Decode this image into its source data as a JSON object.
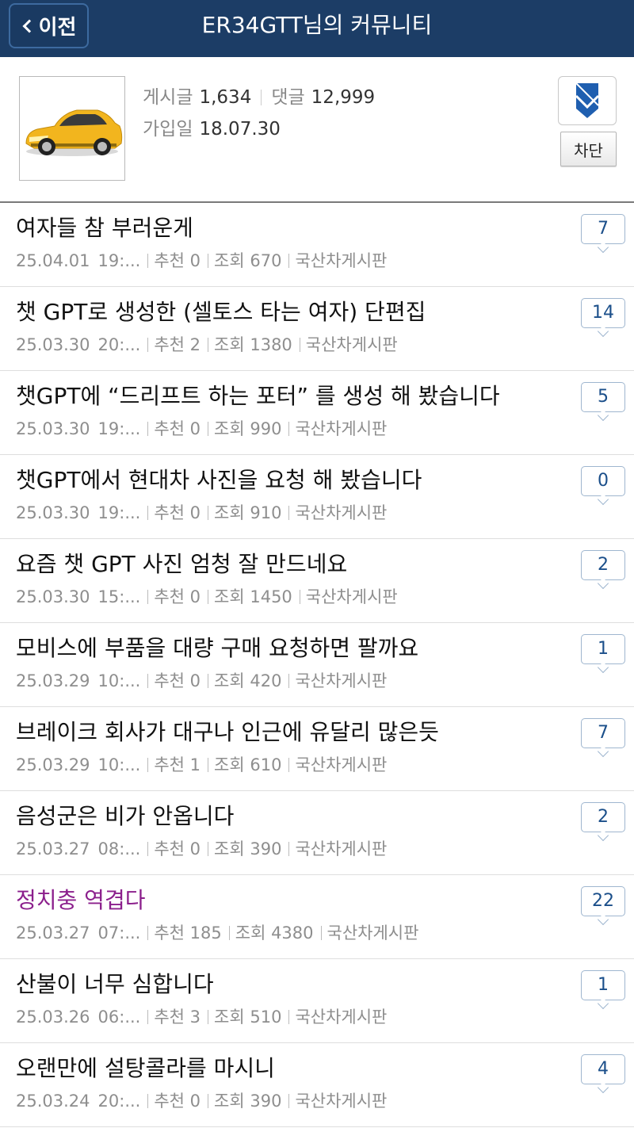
{
  "header": {
    "back_label": "이전",
    "title": "ER34GTT님의 커뮤니티",
    "background_color": "#1c3d66"
  },
  "profile": {
    "posts_label": "게시글",
    "posts_count": "1,634",
    "comments_label": "댓글",
    "comments_count": "12,999",
    "joined_label": "가입일",
    "joined_date": "18.07.30",
    "block_label": "차단",
    "bookmark_icon": "bookmark-icon"
  },
  "posts": [
    {
      "title": "여자들 참 부러운게",
      "date": "25.04.01",
      "time": "19:...",
      "recommend": "추천 0",
      "views": "조회 670",
      "board": "국산차게시판",
      "comments": "7",
      "highlight": false
    },
    {
      "title": "챗 GPT로 생성한 (셀토스 타는 여자) 단편집",
      "date": "25.03.30",
      "time": "20:...",
      "recommend": "추천 2",
      "views": "조회 1380",
      "board": "국산차게시판",
      "comments": "14",
      "highlight": false
    },
    {
      "title": "챗GPT에 “드리프트 하는 포터” 를 생성 해 봤습니다",
      "date": "25.03.30",
      "time": "19:...",
      "recommend": "추천 0",
      "views": "조회 990",
      "board": "국산차게시판",
      "comments": "5",
      "highlight": false
    },
    {
      "title": "챗GPT에서 현대차 사진을 요청 해 봤습니다",
      "date": "25.03.30",
      "time": "19:...",
      "recommend": "추천 0",
      "views": "조회 910",
      "board": "국산차게시판",
      "comments": "0",
      "highlight": false
    },
    {
      "title": "요즘 챗 GPT 사진 엄청 잘 만드네요",
      "date": "25.03.30",
      "time": "15:...",
      "recommend": "추천 0",
      "views": "조회 1450",
      "board": "국산차게시판",
      "comments": "2",
      "highlight": false
    },
    {
      "title": "모비스에 부품을 대량 구매 요청하면 팔까요",
      "date": "25.03.29",
      "time": "10:...",
      "recommend": "추천 0",
      "views": "조회 420",
      "board": "국산차게시판",
      "comments": "1",
      "highlight": false
    },
    {
      "title": "브레이크 회사가 대구나 인근에 유달리 많은듯",
      "date": "25.03.29",
      "time": "10:...",
      "recommend": "추천 1",
      "views": "조회 610",
      "board": "국산차게시판",
      "comments": "7",
      "highlight": false
    },
    {
      "title": "음성군은 비가 안옵니다",
      "date": "25.03.27",
      "time": "08:...",
      "recommend": "추천 0",
      "views": "조회 390",
      "board": "국산차게시판",
      "comments": "2",
      "highlight": false
    },
    {
      "title": "정치충 역겹다",
      "date": "25.03.27",
      "time": "07:...",
      "recommend": "추천 185",
      "views": "조회 4380",
      "board": "국산차게시판",
      "comments": "22",
      "highlight": true
    },
    {
      "title": "산불이 너무 심합니다",
      "date": "25.03.26",
      "time": "06:...",
      "recommend": "추천 3",
      "views": "조회 510",
      "board": "국산차게시판",
      "comments": "1",
      "highlight": false
    },
    {
      "title": "오랜만에 설탕콜라를 마시니",
      "date": "25.03.24",
      "time": "20:...",
      "recommend": "추천 0",
      "views": "조회 390",
      "board": "국산차게시판",
      "comments": "4",
      "highlight": false
    }
  ]
}
